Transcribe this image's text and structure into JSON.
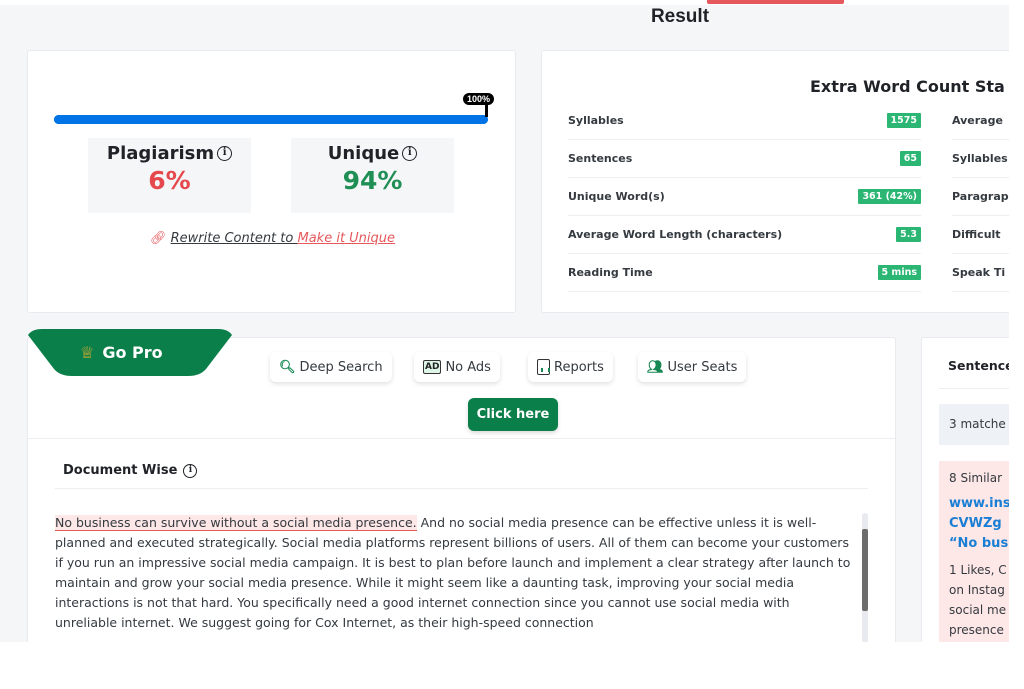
{
  "header": {
    "title": "Result"
  },
  "score": {
    "progress_percent": 100,
    "progress_label": "100%",
    "plagiarism_label": "Plagiarism",
    "plagiarism_value": "6%",
    "unique_label": "Unique",
    "unique_value": "94%",
    "rewrite_text": "Rewrite Content to ",
    "rewrite_link": "Make it Unique"
  },
  "stats": {
    "title": "Extra Word Count Sta",
    "left": [
      {
        "label": "Syllables",
        "value": "1575"
      },
      {
        "label": "Sentences",
        "value": "65"
      },
      {
        "label": "Unique Word(s)",
        "value": "361 (42%)"
      },
      {
        "label": "Average Word Length (characters)",
        "value": "5.3"
      },
      {
        "label": "Reading Time",
        "value": "5 mins"
      }
    ],
    "right": [
      {
        "label": "Average"
      },
      {
        "label": "Syllables"
      },
      {
        "label": "Paragrap"
      },
      {
        "label": "Difficult"
      },
      {
        "label": "Speak Ti"
      }
    ],
    "badge_color": "#2bb673"
  },
  "promo": {
    "gopro_label": "Go Pro",
    "features": [
      {
        "label": "Deep Search",
        "icon": "search-icon"
      },
      {
        "label": "No Ads",
        "icon": "no-ads-icon"
      },
      {
        "label": "Reports",
        "icon": "report-icon"
      },
      {
        "label": "User Seats",
        "icon": "users-icon"
      }
    ],
    "cta_label": "Click here",
    "brand_color": "#0b7f4a"
  },
  "document": {
    "heading": "Document Wise",
    "highlighted_sentence": "No business can survive without a social media presence.",
    "rest_text": " And no social media presence can be effective unless it is well-planned and executed strategically. Social media platforms represent billions of users. All of them can become your customers if you run an impressive social media campaign. It is best to plan before launch and implement a clear strategy after launch to maintain and grow your social media presence. While it might seem like a daunting task, improving your social media interactions is not that hard. You specifically need a good internet connection since you cannot use social media with unreliable internet. We suggest going for Cox Internet, as their high-speed connection"
  },
  "sidebar": {
    "title": "Sentence",
    "matches": "3 matche",
    "similar_count": "8 Similar",
    "link_lines": [
      "www.ins",
      "CVWZg",
      "“No bus"
    ],
    "body_lines": [
      "1 Likes, C",
      "on Instag",
      "social me",
      "presence"
    ]
  }
}
